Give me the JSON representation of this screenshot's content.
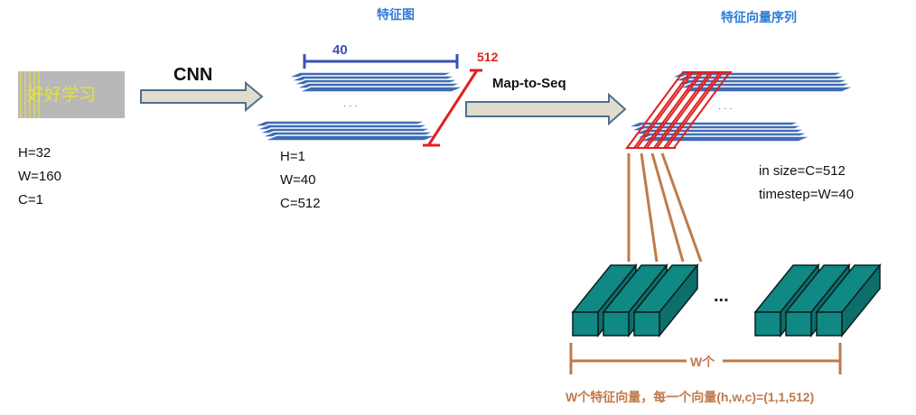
{
  "input": {
    "image_text": "好好学习",
    "dims": [
      "H=32",
      "W=160",
      "C=1"
    ]
  },
  "cnn_label": "CNN",
  "feature_map": {
    "title": "特征图",
    "width_label": "40",
    "depth_label": "512",
    "dots": "·  ·  ·",
    "dims": [
      "H=1",
      "W=40",
      "C=512"
    ]
  },
  "map_to_seq_label": "Map-to-Seq",
  "sequence": {
    "title": "特征向量序列",
    "dots": "·  ·  ·",
    "params": [
      "in size=C=512",
      "timestep=W=40"
    ]
  },
  "vectors": {
    "ellipsis": "...",
    "count_label": "W个",
    "caption": "W个特征向量，每一个向量(h,w,c)=(1,1,512)"
  },
  "colors": {
    "layer_fill": "#3e6cb5",
    "layer_edge": "#ffffff",
    "arrow_fill": "#e2dccb",
    "arrow_edge": "#4d6f92",
    "teal": "#108883",
    "red": "#e02020",
    "brown": "#c07a4a",
    "blue_line": "#3b4fb8",
    "input_bg": "#b8b8b8",
    "input_text": "#e7e23a"
  }
}
